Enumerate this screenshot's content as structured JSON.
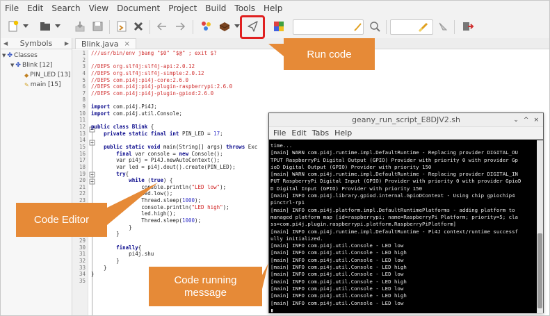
{
  "menubar": {
    "items": [
      "File",
      "Edit",
      "Search",
      "View",
      "Document",
      "Project",
      "Build",
      "Tools",
      "Help"
    ]
  },
  "toolbar": {
    "icons": [
      "new-file-icon",
      "open-file-icon",
      "save-icon",
      "save-all-icon",
      "revert-icon",
      "close-icon",
      "back-icon",
      "forward-icon",
      "compile-icon",
      "build-icon",
      "run-icon",
      "color-chooser-icon",
      "search-icon",
      "clear-icon",
      "jump-icon",
      "quit-icon"
    ]
  },
  "sidebar": {
    "tab_label": "Symbols",
    "tree": [
      {
        "label": "Classes",
        "level": 0
      },
      {
        "label": "Blink [12]",
        "level": 1
      },
      {
        "label": "PIN_LED [13]",
        "level": 2
      },
      {
        "label": "main [15]",
        "level": 2
      }
    ]
  },
  "editor": {
    "tab_label": "Blink.java",
    "close_glyph": "×",
    "line_numbers": [
      "1",
      "2",
      "3",
      "4",
      "5",
      "6",
      "7",
      "8",
      "9",
      "10",
      "11",
      "12",
      "13",
      "14",
      "15",
      "16",
      "17",
      "18",
      "19",
      "20",
      "21",
      "22",
      "23",
      "24",
      "25",
      "26",
      "27",
      "28",
      "29",
      "30",
      "31",
      "32",
      "33",
      "34",
      "35"
    ],
    "lines": [
      [
        {
          "t": "///usr/bin/env jbang \"$0\" \"$@\" ; exit $?",
          "c": "cm"
        }
      ],
      [],
      [
        {
          "t": "//DEPS org.slf4j:slf4j-api:2.0.12",
          "c": "cm"
        }
      ],
      [
        {
          "t": "//DEPS org.slf4j:slf4j-simple:2.0.12",
          "c": "cm"
        }
      ],
      [
        {
          "t": "//DEPS com.pi4j:pi4j-core:2.6.0",
          "c": "cm"
        }
      ],
      [
        {
          "t": "//DEPS com.pi4j:pi4j-plugin-raspberrypi:2.6.0",
          "c": "cm"
        }
      ],
      [
        {
          "t": "//DEPS com.pi4j:pi4j-plugin-gpiod:2.6.0",
          "c": "cm"
        }
      ],
      [],
      [
        {
          "t": "import",
          "c": "kw"
        },
        {
          "t": " com.pi4j.Pi4J;",
          "c": "pl"
        }
      ],
      [
        {
          "t": "import",
          "c": "kw"
        },
        {
          "t": " com.pi4j.util.Console;",
          "c": "pl"
        }
      ],
      [],
      [
        {
          "t": "public class Blink",
          "c": "kw"
        },
        {
          "t": " {",
          "c": "pl"
        }
      ],
      [
        {
          "t": "    ",
          "c": "pl"
        },
        {
          "t": "private static final int",
          "c": "kw"
        },
        {
          "t": " PIN_LED = ",
          "c": "pl"
        },
        {
          "t": "17",
          "c": "num"
        },
        {
          "t": ";",
          "c": "pl"
        }
      ],
      [],
      [
        {
          "t": "    ",
          "c": "pl"
        },
        {
          "t": "public static void",
          "c": "kw"
        },
        {
          "t": " main(String[] args) ",
          "c": "pl"
        },
        {
          "t": "throws",
          "c": "kw"
        },
        {
          "t": " Exc",
          "c": "pl"
        }
      ],
      [
        {
          "t": "        ",
          "c": "pl"
        },
        {
          "t": "final",
          "c": "kw"
        },
        {
          "t": " var console = ",
          "c": "pl"
        },
        {
          "t": "new",
          "c": "kw"
        },
        {
          "t": " Console();",
          "c": "pl"
        }
      ],
      [
        {
          "t": "        var pi4j = Pi4J.newAutoContext();",
          "c": "pl"
        }
      ],
      [
        {
          "t": "        var led = pi4j.dout().create(PIN_LED);",
          "c": "pl"
        }
      ],
      [
        {
          "t": "        ",
          "c": "pl"
        },
        {
          "t": "try",
          "c": "kw"
        },
        {
          "t": "{",
          "c": "pl"
        }
      ],
      [
        {
          "t": "            ",
          "c": "pl"
        },
        {
          "t": "while",
          "c": "kw"
        },
        {
          "t": " (",
          "c": "pl"
        },
        {
          "t": "true",
          "c": "kw"
        },
        {
          "t": ") {",
          "c": "pl"
        }
      ],
      [
        {
          "t": "                console.println(",
          "c": "pl"
        },
        {
          "t": "\"LED low\"",
          "c": "str"
        },
        {
          "t": ");",
          "c": "pl"
        }
      ],
      [
        {
          "t": "                led.low();",
          "c": "pl"
        }
      ],
      [
        {
          "t": "                Thread.sleep(",
          "c": "pl"
        },
        {
          "t": "1000",
          "c": "num"
        },
        {
          "t": ");",
          "c": "pl"
        }
      ],
      [
        {
          "t": "                console.println(",
          "c": "pl"
        },
        {
          "t": "\"LED high\"",
          "c": "str"
        },
        {
          "t": ");",
          "c": "pl"
        }
      ],
      [
        {
          "t": "                led.high();",
          "c": "pl"
        }
      ],
      [
        {
          "t": "                Thread.sleep(",
          "c": "pl"
        },
        {
          "t": "1000",
          "c": "num"
        },
        {
          "t": ");",
          "c": "pl"
        }
      ],
      [
        {
          "t": "            }",
          "c": "pl"
        }
      ],
      [
        {
          "t": "        }",
          "c": "pl"
        }
      ],
      [],
      [
        {
          "t": "        ",
          "c": "pl"
        },
        {
          "t": "finally",
          "c": "kw"
        },
        {
          "t": "{",
          "c": "pl"
        }
      ],
      [
        {
          "t": "            pi4j.shu",
          "c": "pl"
        }
      ],
      [
        {
          "t": "        }",
          "c": "pl"
        }
      ],
      [
        {
          "t": "    }",
          "c": "pl"
        }
      ],
      [
        {
          "t": "}",
          "c": "pl"
        }
      ],
      []
    ]
  },
  "terminal": {
    "title": "geany_run_script_E8DJV2.sh",
    "menu": [
      "File",
      "Edit",
      "Tabs",
      "Help"
    ],
    "controls": [
      "⌄",
      "^",
      "×"
    ],
    "lines": [
      "time...",
      "[main] WARN com.pi4j.runtime.impl.DefaultRuntime - Replacing provider DIGITAL_OU",
      "TPUT RaspberryPi Digital Output (GPIO) Provider with priority 0 with provider Gp",
      "ioD Digital Output (GPIO) Provider with priority 150",
      "[main] WARN com.pi4j.runtime.impl.DefaultRuntime - Replacing provider DIGITAL_IN",
      "PUT RaspberryPi Digital Input (GPIO) Provider with priority 0 with provider GpioD",
      "D Digital Input (GPIO) Provider with priority 150",
      "[main] INFO com.pi4j.library.gpiod.internal.GpioDContext - Using chip gpiochip4",
      "pinctrl-rp1",
      "[main] INFO com.pi4j.platform.impl.DefaultRuntimePlatforms - adding platform to",
      "managed platform map [id=raspberrypi; name=RaspberryPi Platform; priority=5; cla",
      "ss=com.pi4j.plugin.raspberrypi.platform.RaspberryPiPlatform]",
      "[main] INFO com.pi4j.runtime.impl.DefaultRuntime - Pi4J context/runtime successf",
      "ully initialized.",
      "[main] INFO com.pi4j.util.Console - LED low",
      "[main] INFO com.pi4j.util.Console - LED high",
      "[main] INFO com.pi4j.util.Console - LED low",
      "[main] INFO com.pi4j.util.Console - LED high",
      "[main] INFO com.pi4j.util.Console - LED low",
      "[main] INFO com.pi4j.util.Console - LED high",
      "[main] INFO com.pi4j.util.Console - LED low",
      "[main] INFO com.pi4j.util.Console - LED high",
      "[main] INFO com.pi4j.util.Console - LED low",
      "▮"
    ]
  },
  "callouts": {
    "run_code": "Run code",
    "code_editor": "Code Editor",
    "code_running_line1": "Code running",
    "code_running_line2": "message"
  },
  "colors": {
    "callout": "#e68a37",
    "highlight": "#e02020",
    "terminal_bg": "#000000",
    "comment": "#d03030",
    "keyword": "#0a0a8c"
  }
}
